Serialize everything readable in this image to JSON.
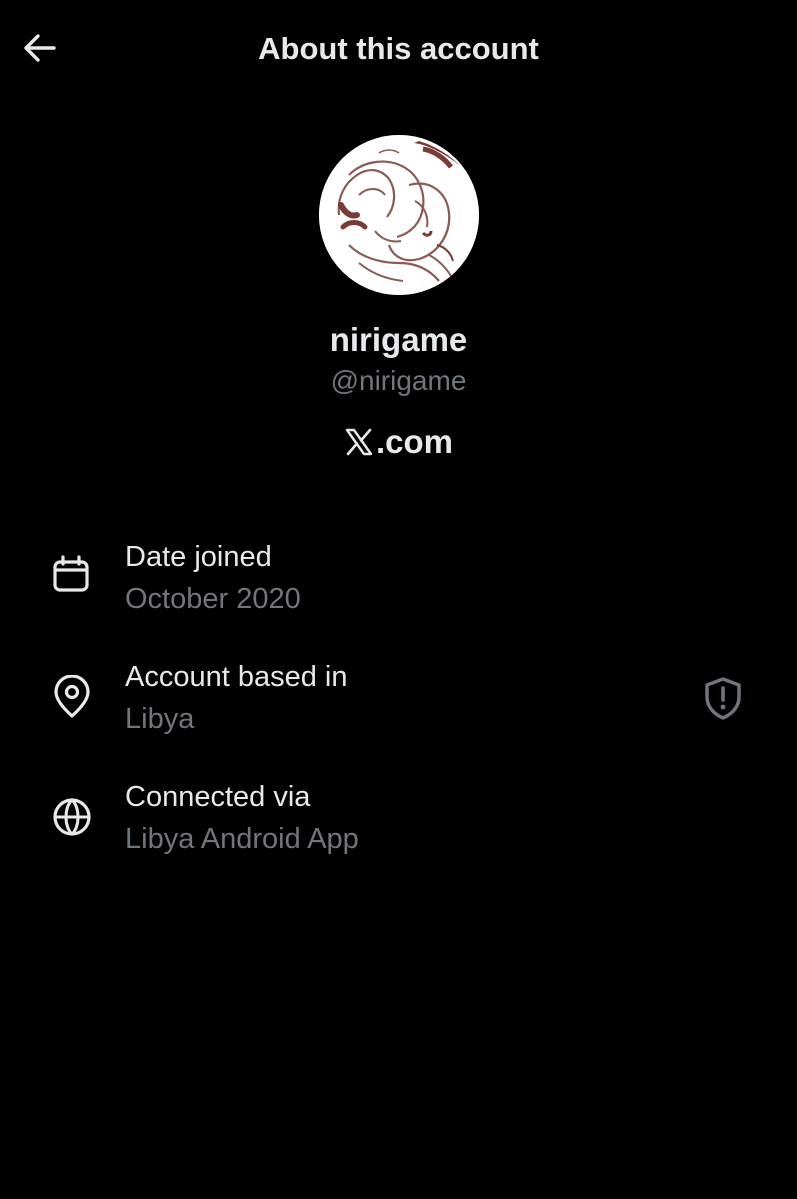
{
  "header": {
    "title": "About this account",
    "back_icon": "arrow-left-icon"
  },
  "profile": {
    "display_name": "nirigame",
    "handle": "@nirigame",
    "site_suffix": ".com",
    "site_logo_icon": "x-logo-icon"
  },
  "details": [
    {
      "icon": "calendar-icon",
      "label": "Date joined",
      "value": "October 2020"
    },
    {
      "icon": "location-pin-icon",
      "label": "Account based in",
      "value": "Libya",
      "trailing_icon": "shield-alert-icon"
    },
    {
      "icon": "globe-icon",
      "label": "Connected via",
      "value": "Libya Android App"
    }
  ],
  "colors": {
    "background": "#000000",
    "primary_text": "#e7e9ea",
    "secondary_text": "#71767b",
    "avatar_line": "#8a5a55"
  }
}
